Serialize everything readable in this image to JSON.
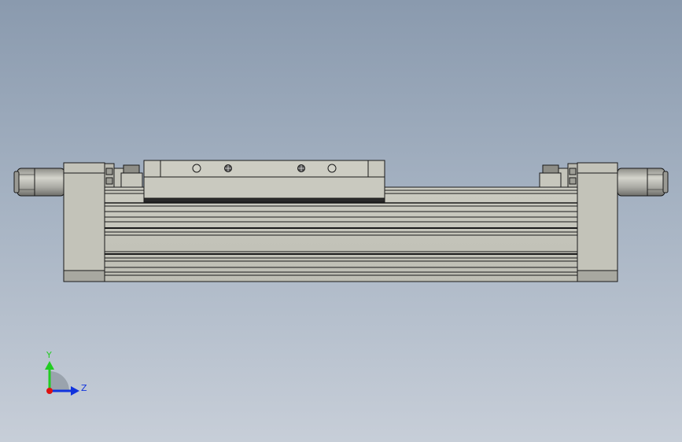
{
  "viewport": {
    "background_top": "#8a9aae",
    "background_bottom": "#c7ced8"
  },
  "model": {
    "body_color": "#c6c6bc",
    "edge_color": "#1a1a1a",
    "cap_color": "#bdbdb3",
    "carriage_color": "#c9c9bf",
    "connector_color": "#a9a9a3"
  },
  "triad": {
    "y_label": "Y",
    "z_label": "Z",
    "y_color": "#22cc22",
    "z_color": "#1133dd",
    "x_color": "#dd1111"
  }
}
